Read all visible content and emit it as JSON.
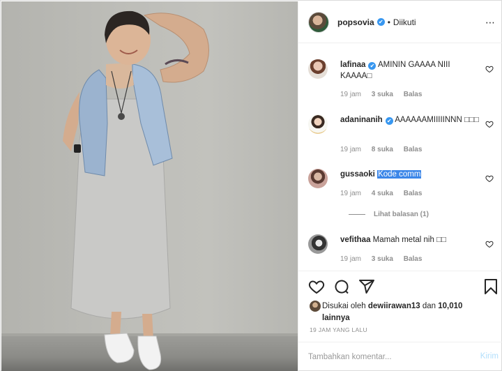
{
  "post": {
    "owner": {
      "username": "popsovia",
      "verified_mark": "✔",
      "follow_separator": "•",
      "follow_status": "Diikuti",
      "more_icon": "⋯"
    },
    "comments": [
      {
        "username": "lafinaa",
        "verified": true,
        "text": "AMININ GAAAA NIII KAAAA□",
        "time": "19 jam",
        "likes": "3 suka",
        "reply_label": "Balas"
      },
      {
        "username": "adaninanih",
        "verified": true,
        "text": "AAAAAAMIIIIINNN □□□",
        "time": "19 jam",
        "likes": "8 suka",
        "reply_label": "Balas"
      },
      {
        "username": "gussaoki",
        "verified": false,
        "text": "Kode comm",
        "time": "19 jam",
        "likes": "4 suka",
        "reply_label": "Balas",
        "view_replies": "Lihat balasan (1)"
      },
      {
        "username": "vefithaa",
        "verified": false,
        "text": "Mamah metal nih □□",
        "time": "19 jam",
        "likes": "3 suka",
        "reply_label": "Balas"
      }
    ],
    "liked_by": {
      "prefix": "Disukai oleh",
      "user": "dewiirawan13",
      "connector": "dan",
      "others": "10,010 lainnya"
    },
    "time_ago": "19 JAM YANG LALU",
    "add_comment": {
      "placeholder": "Tambahkan komentar...",
      "post_label": "Kirim"
    },
    "icons": {
      "like": "heart-icon",
      "comment": "comment-icon",
      "share": "share-icon",
      "save": "bookmark-icon"
    },
    "colors": {
      "link_blue": "#3897f0",
      "text": "#262626",
      "muted": "#8e8e8e",
      "selection": "#3b86e8"
    }
  }
}
